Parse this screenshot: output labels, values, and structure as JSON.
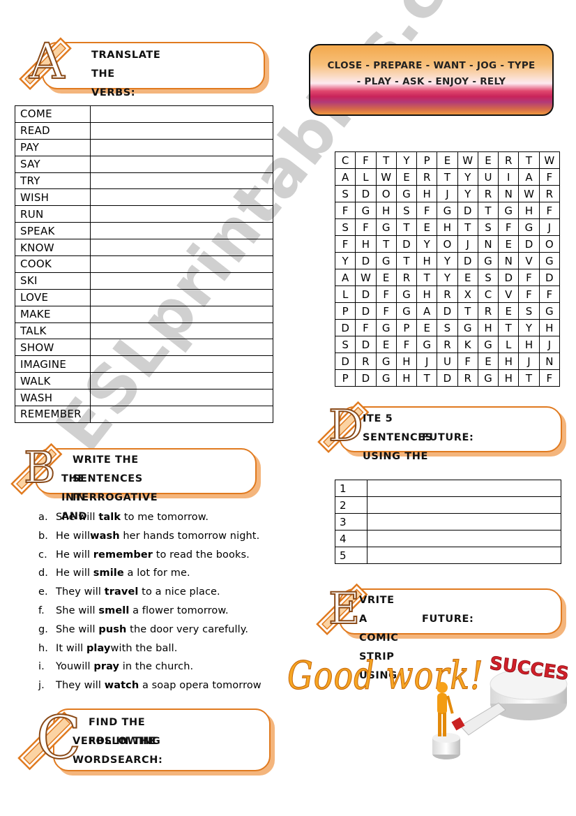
{
  "sections": {
    "a": {
      "letter": "A",
      "title_line1": "TRANSLATE THE VERBS:"
    },
    "b": {
      "letter": "B",
      "title_line1": "WRITE THE SENTENCES IN",
      "title_line2": "THE INTERROGATIVE AND"
    },
    "c": {
      "letter": "C",
      "title_line1": "FIND THE FOLLOWING",
      "title_line2": "VERBS IN THE WORDSEARCH:"
    },
    "d": {
      "letter": "D",
      "title_line1": "ITE 5 SENTENCES USING THE",
      "title_line2": "FUTURE:"
    },
    "e": {
      "letter": "E",
      "title_line1": "VRITE A COMIC STRIP USING",
      "title_line2": "FUTURE:"
    }
  },
  "verb_table": {
    "rows": [
      {
        "verb": "COME",
        "translation": ""
      },
      {
        "verb": "READ",
        "translation": ""
      },
      {
        "verb": "PAY",
        "translation": ""
      },
      {
        "verb": "SAY",
        "translation": ""
      },
      {
        "verb": "TRY",
        "translation": ""
      },
      {
        "verb": "WISH",
        "translation": ""
      },
      {
        "verb": "RUN",
        "translation": ""
      },
      {
        "verb": "SPEAK",
        "translation": ""
      },
      {
        "verb": "KNOW",
        "translation": ""
      },
      {
        "verb": "COOK",
        "translation": ""
      },
      {
        "verb": "SKI",
        "translation": ""
      },
      {
        "verb": "LOVE",
        "translation": ""
      },
      {
        "verb": "MAKE",
        "translation": ""
      },
      {
        "verb": "TALK",
        "translation": ""
      },
      {
        "verb": "SHOW",
        "translation": ""
      },
      {
        "verb": "IMAGINE",
        "translation": ""
      },
      {
        "verb": "WALK",
        "translation": ""
      },
      {
        "verb": "WASH",
        "translation": ""
      },
      {
        "verb": "REMEMBER",
        "translation": ""
      }
    ]
  },
  "word_list_banner": {
    "line1": "CLOSE - PREPARE - WANT - JOG - TYPE",
    "line2": "- PLAY - ASK - ENJOY - RELY"
  },
  "wordsearch": {
    "rows": [
      [
        "C",
        "F",
        "T",
        "Y",
        "P",
        "E",
        "W",
        "E",
        "R",
        "T",
        "W"
      ],
      [
        "A",
        "L",
        "W",
        "E",
        "R",
        "T",
        "Y",
        "U",
        "I",
        "A",
        "F"
      ],
      [
        "S",
        "D",
        "O",
        "G",
        "H",
        "J",
        "Y",
        "R",
        "N",
        "W",
        "R"
      ],
      [
        "F",
        "G",
        "H",
        "S",
        "F",
        "G",
        "D",
        "T",
        "G",
        "H",
        "F"
      ],
      [
        "S",
        "F",
        "G",
        "T",
        "E",
        "H",
        "T",
        "S",
        "F",
        "G",
        "J"
      ],
      [
        "F",
        "H",
        "T",
        "D",
        "Y",
        "O",
        "J",
        "N",
        "E",
        "D",
        "O"
      ],
      [
        "Y",
        "D",
        "G",
        "T",
        "H",
        "Y",
        "D",
        "G",
        "N",
        "V",
        "G"
      ],
      [
        "A",
        "W",
        "E",
        "R",
        "T",
        "Y",
        "E",
        "S",
        "D",
        "F",
        "D"
      ],
      [
        "L",
        "D",
        "F",
        "G",
        "H",
        "R",
        "X",
        "C",
        "V",
        "F",
        "F"
      ],
      [
        "P",
        "D",
        "F",
        "G",
        "A",
        "D",
        "T",
        "R",
        "E",
        "S",
        "G"
      ],
      [
        "D",
        "F",
        "G",
        "P",
        "E",
        "S",
        "G",
        "H",
        "T",
        "Y",
        "H"
      ],
      [
        "S",
        "D",
        "E",
        "F",
        "G",
        "R",
        "K",
        "G",
        "L",
        "H",
        "J"
      ],
      [
        "D",
        "R",
        "G",
        "H",
        "J",
        "U",
        "F",
        "E",
        "H",
        "J",
        "N"
      ],
      [
        "P",
        "D",
        "G",
        "H",
        "T",
        "D",
        "R",
        "G",
        "H",
        "T",
        "F"
      ]
    ]
  },
  "sentences": [
    {
      "label": "a.",
      "before": "She will ",
      "verb": "talk",
      "after": " to me tomorrow."
    },
    {
      "label": "b.",
      "before": "He will",
      "verb": "wash",
      "after": " her hands tomorrow night."
    },
    {
      "label": "c.",
      "before": "He will ",
      "verb": "remember",
      "after": " to read the books."
    },
    {
      "label": "d.",
      "before": "He will ",
      "verb": "smile",
      "after": " a lot for me."
    },
    {
      "label": "e.",
      "before": "They will ",
      "verb": "travel",
      "after": " to a nice place."
    },
    {
      "label": "f.",
      "before": "She will ",
      "verb": "smell",
      "after": " a flower tomorrow."
    },
    {
      "label": "g.",
      "before": "She will ",
      "verb": "push",
      "after": " the door very carefully."
    },
    {
      "label": "h.",
      "before": "It will ",
      "verb": "play",
      "after": "with the ball."
    },
    {
      "label": "i.",
      "before": "Youwill ",
      "verb": "pray",
      "after": " in the church."
    },
    {
      "label": "j.",
      "before": "They will ",
      "verb": "watch",
      "after": " a soap opera tomorrow"
    }
  ],
  "numbered_table": {
    "rows": [
      {
        "num": "1",
        "answer": ""
      },
      {
        "num": "2",
        "answer": ""
      },
      {
        "num": "3",
        "answer": ""
      },
      {
        "num": "4",
        "answer": ""
      },
      {
        "num": "5",
        "answer": ""
      }
    ]
  },
  "closing": {
    "good_work": "Good work!",
    "success": "SUCCESS"
  },
  "watermark": "ESLprintables.com",
  "colors": {
    "accent_orange": "#e07a1f",
    "shadow_orange": "#f4b57c",
    "good_work": "#f6a623",
    "success_red": "#d0202a"
  }
}
